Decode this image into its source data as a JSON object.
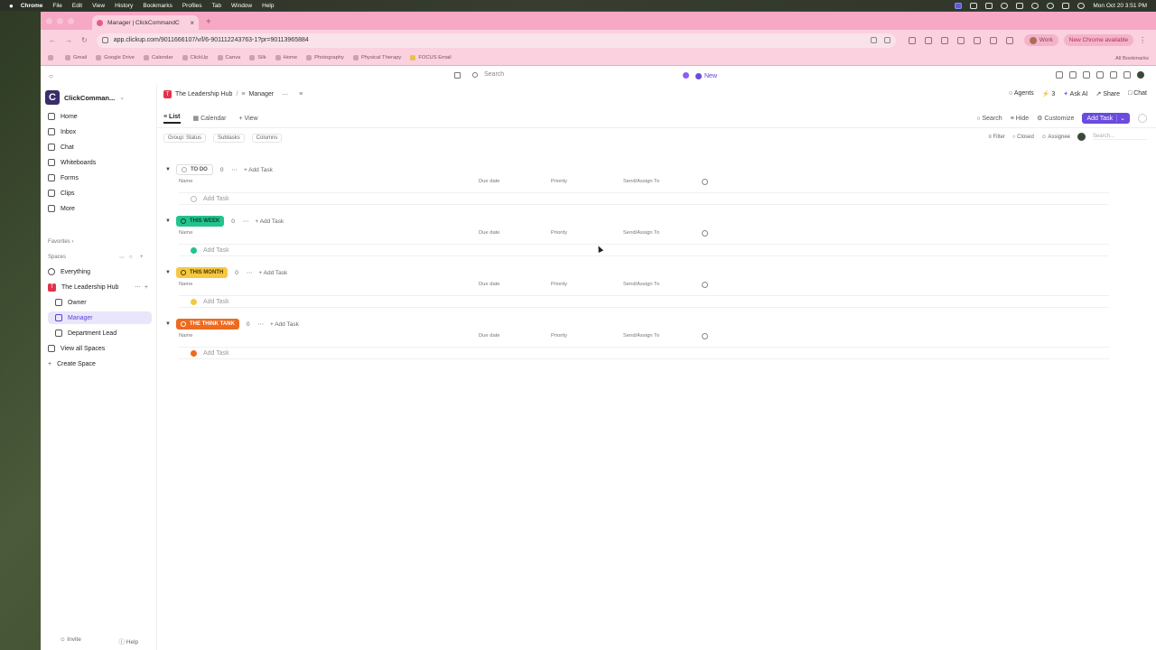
{
  "menubar": {
    "app": "Chrome",
    "items": [
      "File",
      "Edit",
      "View",
      "History",
      "Bookmarks",
      "Profiles",
      "Tab",
      "Window",
      "Help"
    ],
    "clock": "Mon Oct 20  3:51 PM"
  },
  "browser": {
    "tab_title": "Manager | ClickCommandC",
    "url": "app.clickup.com/9011666107/v/l/6-901112243763-1?pr=90113965884",
    "profile": "Work",
    "update_label": "New Chrome available",
    "bookmarks": [
      "Gmail",
      "Google Drive",
      "Calendar",
      "ClickUp",
      "Canva",
      "Silk",
      "Home",
      "Photography",
      "Physical Therapy",
      "FOCUS Email"
    ],
    "all_bookmarks": "All Bookmarks"
  },
  "apptop": {
    "search_label": "Search",
    "new_label": "New"
  },
  "sidebar": {
    "workspace": "ClickComman...",
    "nav": {
      "home": "Home",
      "inbox": "Inbox",
      "chat": "Chat",
      "whiteboards": "Whiteboards",
      "forms": "Forms",
      "clips": "Clips",
      "more": "More"
    },
    "favorites_label": "Favorites",
    "spaces_label": "Spaces",
    "everything": "Everything",
    "space": {
      "badge": "T",
      "name": "The Leadership Hub"
    },
    "lists": {
      "owner": "Owner",
      "manager": "Manager",
      "department_lead": "Department Lead"
    },
    "view_all_spaces": "View all Spaces",
    "create_space": "Create Space",
    "footer": {
      "invite": "Invite",
      "help": "Help"
    }
  },
  "header": {
    "breadcrumb_space": "The Leadership Hub",
    "breadcrumb_sep": "/",
    "breadcrumb_list": "Manager",
    "agents": "Agents",
    "bolt_count": "3",
    "ask_ai": "Ask AI",
    "share": "Share",
    "chat": "Chat"
  },
  "views": {
    "list": "List",
    "calendar": "Calendar",
    "add_view": "View"
  },
  "tools": {
    "search": "Search",
    "hide": "Hide",
    "customize": "Customize",
    "add_task": "Add Task"
  },
  "filters": {
    "group": "Group: Status",
    "subtasks": "Subtasks",
    "columns": "Columns",
    "filter": "Filter",
    "closed": "Closed",
    "assignee": "Assignee",
    "search_placeholder": "Search..."
  },
  "columns": {
    "name": "Name",
    "due_date": "Due date",
    "priority": "Priority",
    "assign": "Send/Assign To"
  },
  "groups": [
    {
      "label": "TO DO",
      "count": "0",
      "add": "Add Task",
      "row_label": "Add Task",
      "bg": "#ffffff",
      "fg": "#555555",
      "dot": "#aaaaaa"
    },
    {
      "label": "THIS WEEK",
      "count": "0",
      "add": "Add Task",
      "row_label": "Add Task",
      "bg": "#22c38e",
      "fg": "#0f3d2c",
      "dot": "#22c38e"
    },
    {
      "label": "THIS MONTH",
      "count": "0",
      "add": "Add Task",
      "row_label": "Add Task",
      "bg": "#f5c842",
      "fg": "#4a3a00",
      "dot": "#f5c842"
    },
    {
      "label": "THE THINK TANK",
      "count": "0",
      "add": "Add Task",
      "row_label": "Add Task",
      "bg": "#ee6a1f",
      "fg": "#ffffff",
      "dot": "#ee6a1f"
    }
  ]
}
